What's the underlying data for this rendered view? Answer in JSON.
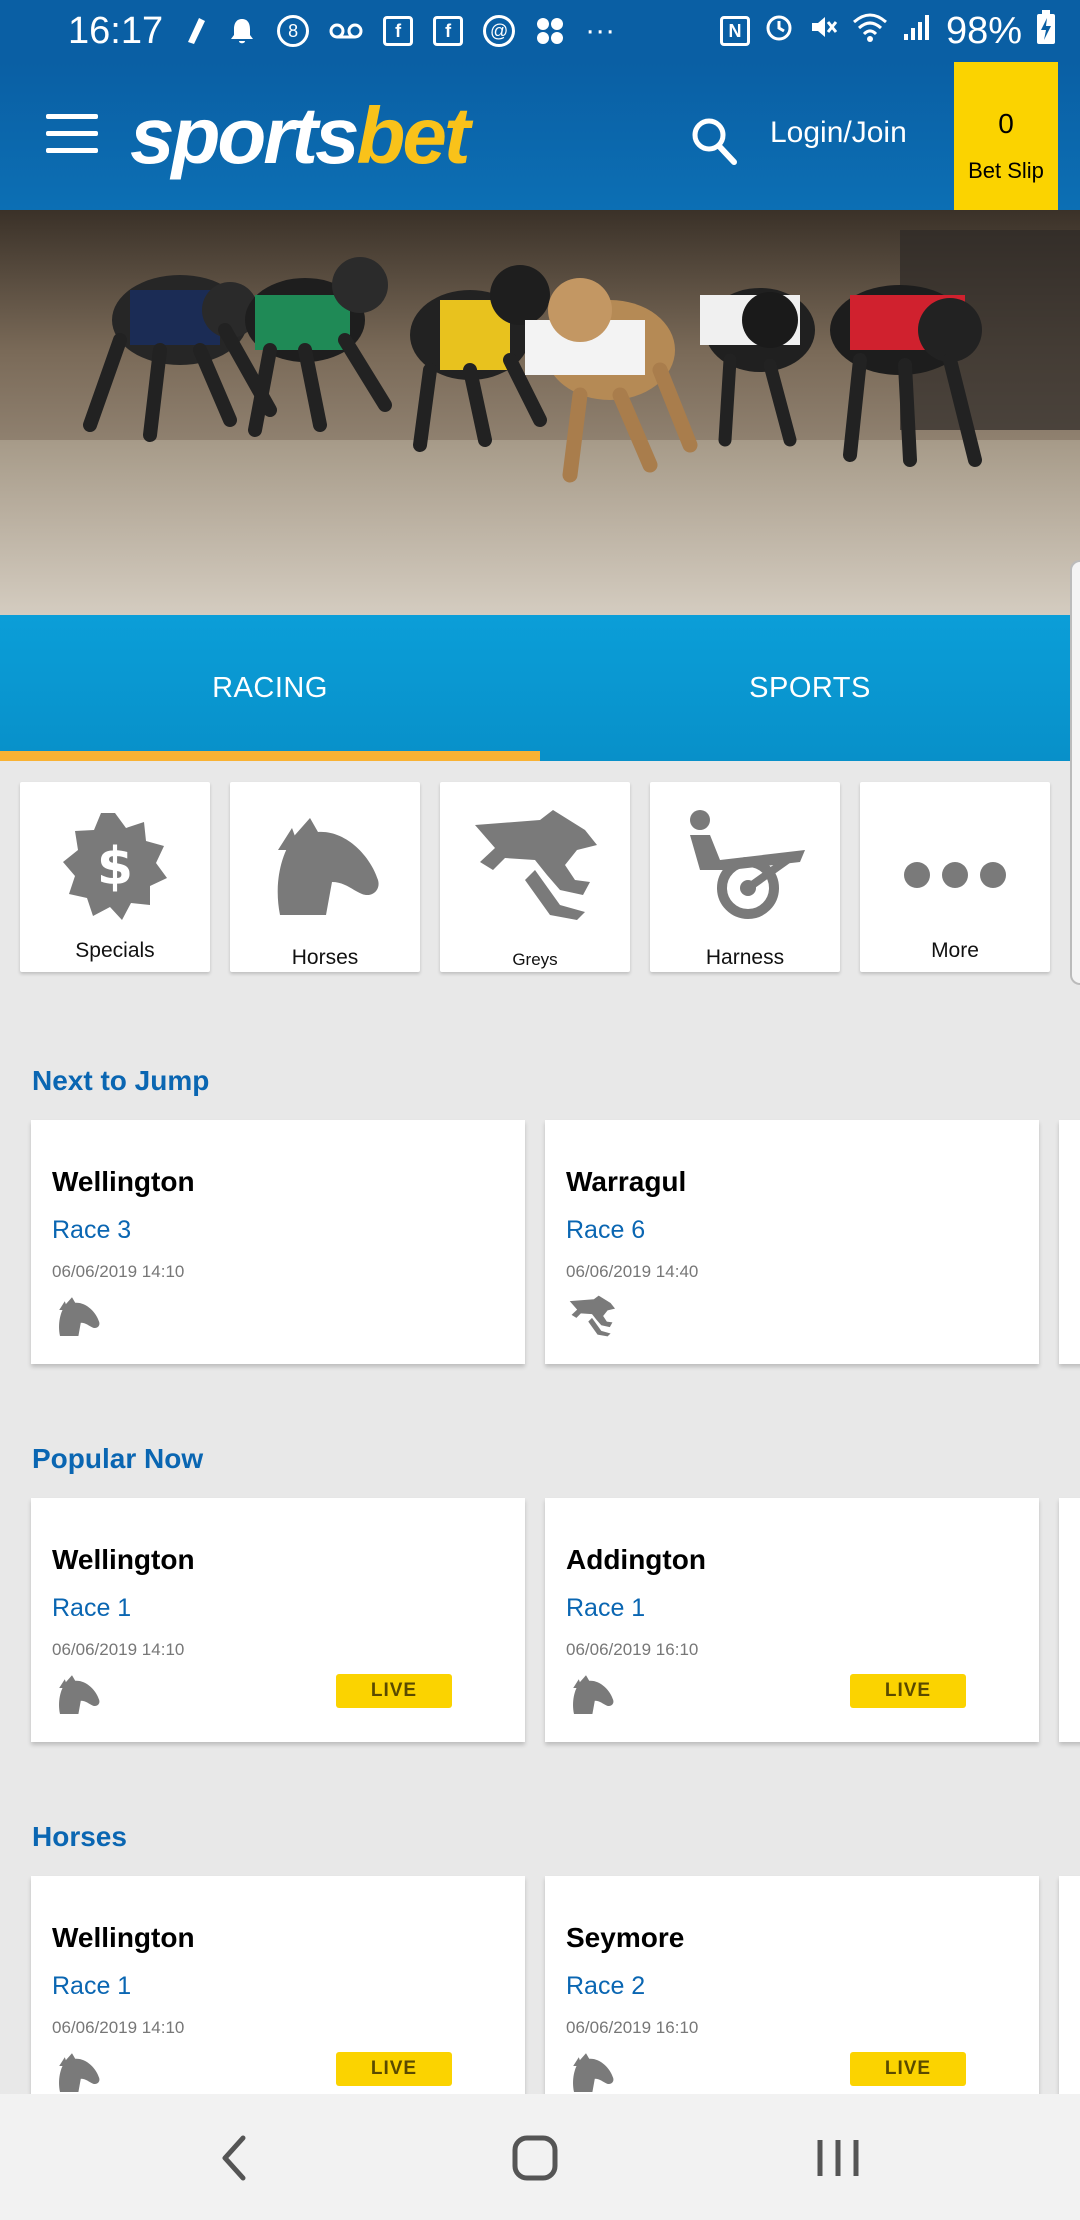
{
  "status_bar": {
    "time": "16:17",
    "more": "···",
    "battery": "98%"
  },
  "header": {
    "logo_part1": "sports",
    "logo_part2": "bet",
    "login_label": "Login/Join",
    "betslip_count": "0",
    "betslip_label": "Bet Slip"
  },
  "tabs": [
    {
      "label": "RACING",
      "active": true
    },
    {
      "label": "SPORTS",
      "active": false
    }
  ],
  "categories": [
    {
      "label": "Specials",
      "icon": "dollar-badge-icon"
    },
    {
      "label": "Horses",
      "icon": "horse-head-icon"
    },
    {
      "label": "Greys",
      "icon": "greyhound-icon"
    },
    {
      "label": "Harness",
      "icon": "harness-icon"
    },
    {
      "label": "More",
      "icon": "more-dots-icon"
    }
  ],
  "sections": [
    {
      "title": "Next to Jump",
      "cards": [
        {
          "venue": "Wellington",
          "race": "Race 3",
          "time": "06/06/2019 14:10",
          "icon": "horse-head-icon",
          "live": ""
        },
        {
          "venue": "Warragul",
          "race": "Race 6",
          "time": "06/06/2019 14:40",
          "icon": "greyhound-icon",
          "live": ""
        }
      ]
    },
    {
      "title": "Popular Now",
      "cards": [
        {
          "venue": "Wellington",
          "race": "Race 1",
          "time": "06/06/2019 14:10",
          "icon": "horse-head-icon",
          "live": "LIVE"
        },
        {
          "venue": "Addington",
          "race": "Race 1",
          "time": "06/06/2019 16:10",
          "icon": "horse-head-icon",
          "live": "LIVE"
        }
      ]
    },
    {
      "title": "Horses",
      "cards": [
        {
          "venue": "Wellington",
          "race": "Race 1",
          "time": "06/06/2019 14:10",
          "icon": "horse-head-icon",
          "live": "LIVE"
        },
        {
          "venue": "Seymore",
          "race": "Race 2",
          "time": "06/06/2019 16:10",
          "icon": "horse-head-icon",
          "live": "LIVE"
        }
      ]
    }
  ],
  "colors": {
    "header_blue": "#0a5fa4",
    "tab_blue": "#0b9ed8",
    "accent_orange": "#f9b233",
    "betslip_yellow": "#fbd300",
    "link_blue": "#0a66b2"
  }
}
